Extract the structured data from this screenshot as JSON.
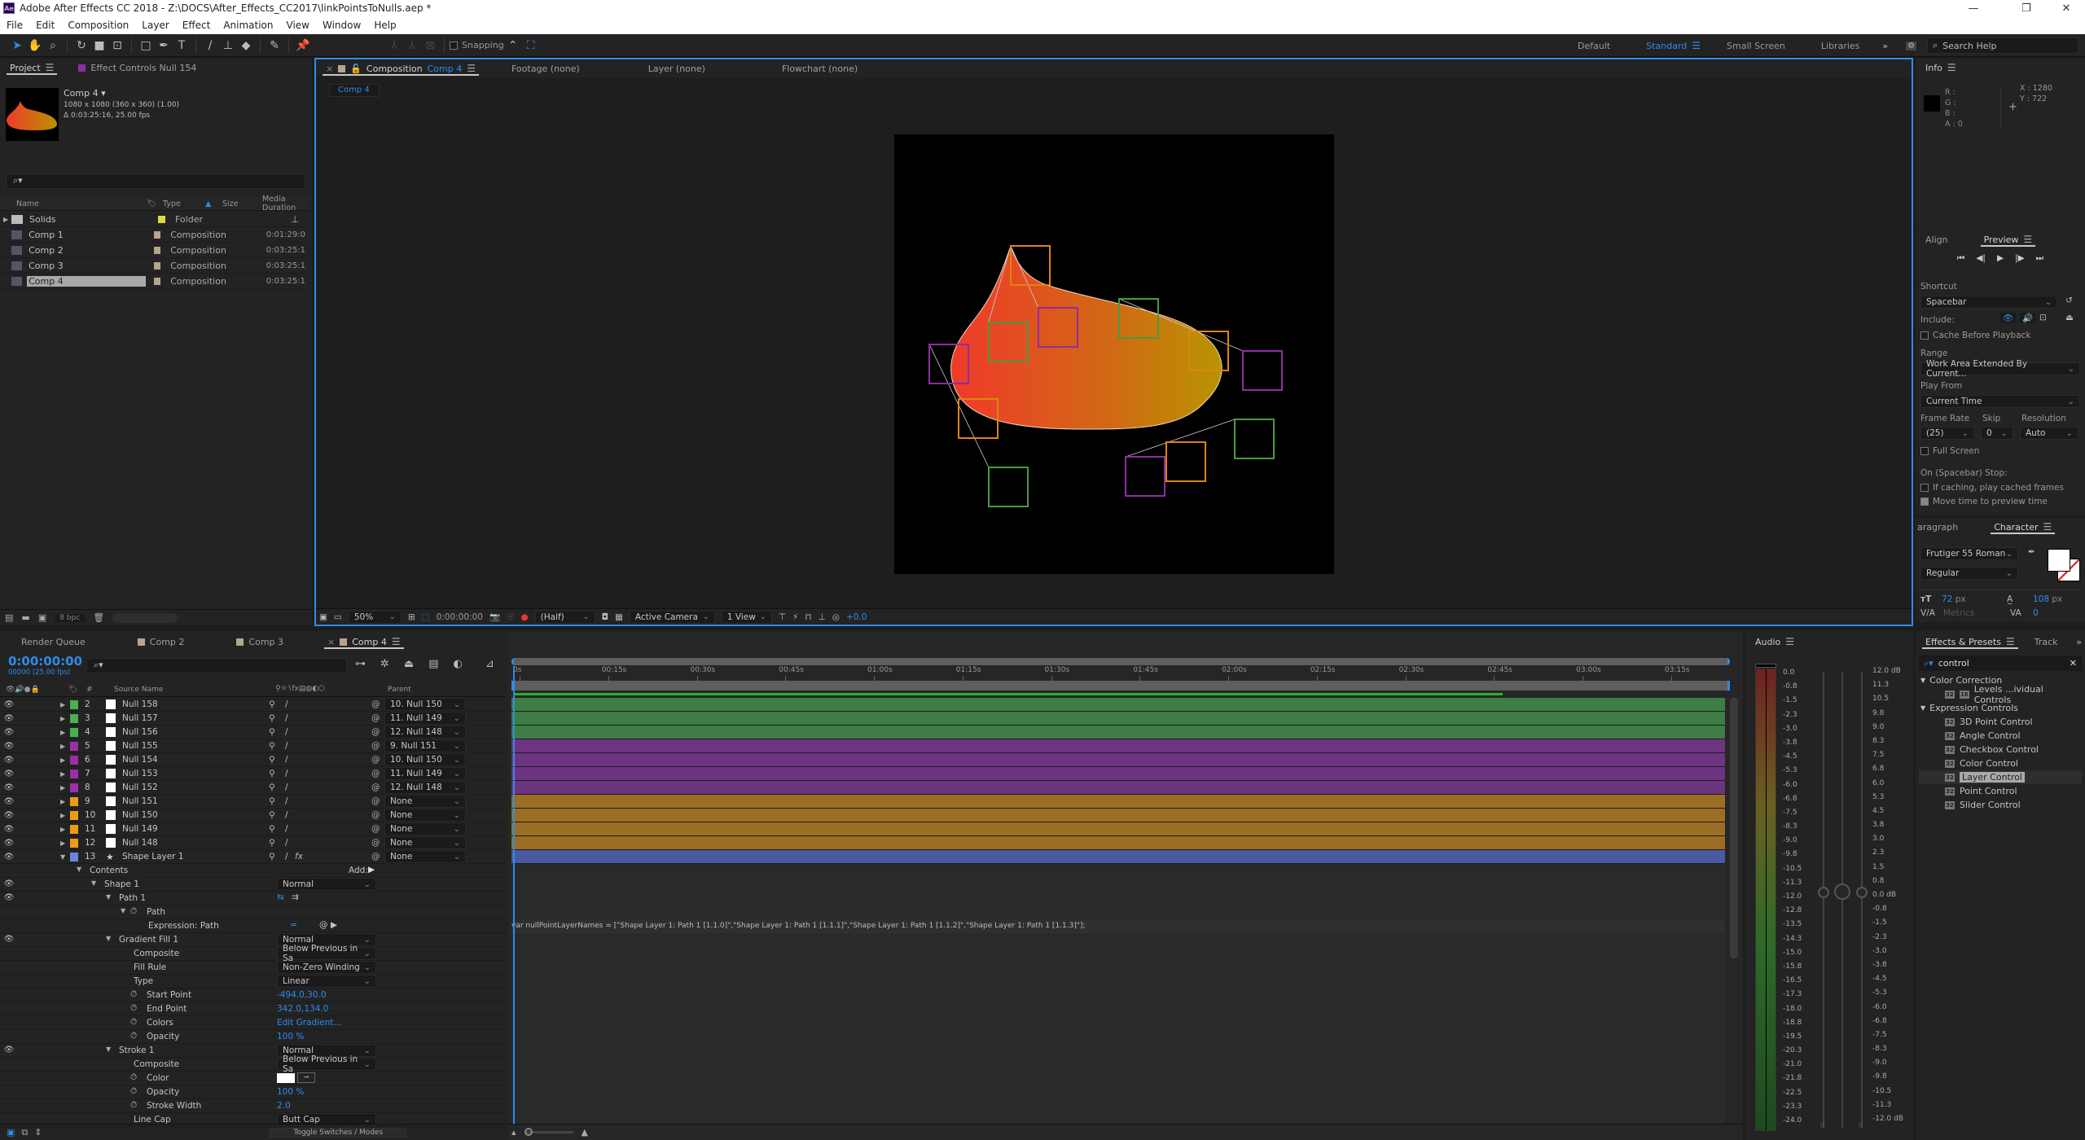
{
  "window": {
    "title": "Adobe After Effects CC 2018 - Z:\\DOCS\\After_Effects_CC2017\\linkPointsToNulls.aep *",
    "app_icon": "Ae",
    "controls": {
      "minimize": "—",
      "restore": "❐",
      "close": "✕"
    }
  },
  "menu": [
    "File",
    "Edit",
    "Composition",
    "Layer",
    "Effect",
    "Animation",
    "View",
    "Window",
    "Help"
  ],
  "toolbar": {
    "tools": [
      "selection-tool",
      "hand-tool",
      "zoom-tool",
      "rotation-tool",
      "camera-tool",
      "pan-behind-tool",
      "rectangle-tool",
      "pen-tool",
      "type-tool",
      "brush-tool",
      "clone-stamp-tool",
      "eraser-tool",
      "roto-brush-tool",
      "puppet-pin-tool"
    ],
    "snapping_label": "Snapping",
    "workspaces": [
      "Default",
      "Standard",
      "Small Screen",
      "Libraries"
    ],
    "active_workspace": "Standard",
    "search_placeholder": "Search Help"
  },
  "project": {
    "tabs": [
      {
        "label": "Project"
      },
      {
        "label": "Effect Controls Null 154",
        "color": "#8e2ea0"
      }
    ],
    "preview": {
      "name": "Comp 4 ▾",
      "dims": "1080 x 1080  (360 x 360) (1.00)",
      "duration": "Δ 0:03:25:16, 25.00 fps"
    },
    "search_placeholder": "",
    "columns": [
      "Name",
      "Type",
      "Size",
      "Media Duration"
    ],
    "items": [
      {
        "name": "Solids",
        "type": "Folder",
        "duration": "",
        "label": "#e2d543",
        "kind": "folder"
      },
      {
        "name": "Comp 1",
        "type": "Composition",
        "duration": "0:01:29:0",
        "label": "#b5a58a",
        "kind": "comp"
      },
      {
        "name": "Comp 2",
        "type": "Composition",
        "duration": "0:03:25:1",
        "label": "#b5a58a",
        "kind": "comp"
      },
      {
        "name": "Comp 3",
        "type": "Composition",
        "duration": "0:03:25:1",
        "label": "#b5a58a",
        "kind": "comp"
      },
      {
        "name": "Comp 4",
        "type": "Composition",
        "duration": "0:03:25:1",
        "label": "#b5a58a",
        "kind": "comp",
        "selected": true
      }
    ],
    "bpc": "8 bpc"
  },
  "composition": {
    "tabs": [
      {
        "label": "Composition",
        "comp": "Comp 4"
      },
      {
        "label": "Footage (none)"
      },
      {
        "label": "Layer (none)"
      },
      {
        "label": "Flowchart (none)"
      }
    ],
    "breadcrumb": "Comp 4",
    "footer": {
      "zoom": "50%",
      "timecode": "0:00:00:00",
      "resolution": "(Half)",
      "camera": "Active Camera",
      "views": "1 View",
      "exposure": "+0.0"
    }
  },
  "info": {
    "title": "Info",
    "r": "R :",
    "g": "G :",
    "b": "B :",
    "a": "A :",
    "a_value": "0",
    "x": "X : 1280",
    "y": "Y :  722"
  },
  "preview": {
    "tabs": [
      "Align",
      "Preview"
    ],
    "shortcut_label": "Shortcut",
    "shortcut": "Spacebar",
    "include_label": "Include:",
    "cache_before_playback": "Cache Before Playback",
    "range_label": "Range",
    "range": "Work Area Extended By Current...",
    "play_from_label": "Play From",
    "play_from": "Current Time",
    "frame_rate_label": "Frame Rate",
    "frame_rate": "(25)",
    "skip_label": "Skip",
    "skip": "0",
    "resolution_label": "Resolution",
    "resolution": "Auto",
    "full_screen": "Full Screen",
    "on_stop_label": "On (Spacebar) Stop:",
    "if_caching": "If caching, play cached frames",
    "move_time": "Move time to preview time",
    "move_time_checked": true
  },
  "character": {
    "tabs": [
      "aragraph",
      "Character"
    ],
    "font": "Frutiger 55 Roman",
    "style": "Regular",
    "size": "72",
    "size_unit": "px",
    "leading": "108",
    "leading_unit": "px",
    "kerning": "Metrics",
    "tracking": "0"
  },
  "timeline": {
    "tabs": [
      {
        "label": "Render Queue"
      },
      {
        "label": "Comp 2"
      },
      {
        "label": "Comp 3"
      },
      {
        "label": "Comp 4",
        "active": true
      }
    ],
    "timecode": "0:00:00:00",
    "frames": "00000 (25.00 fps)",
    "columns": {
      "num": "#",
      "source": "Source Name",
      "parent": "Parent"
    },
    "ruler": [
      "0s",
      "00:15s",
      "00:30s",
      "00:45s",
      "01:00s",
      "01:15s",
      "01:30s",
      "01:45s",
      "02:00s",
      "02:15s",
      "02:30s",
      "02:45s",
      "03:00s",
      "03:15s"
    ],
    "layers": [
      {
        "num": "2",
        "name": "Null 158",
        "label": "#4caf50",
        "parent": "10. Null 150",
        "bar": "#3e7d45"
      },
      {
        "num": "3",
        "name": "Null 157",
        "label": "#4caf50",
        "parent": "11. Null 149",
        "bar": "#3e7d45"
      },
      {
        "num": "4",
        "name": "Null 156",
        "label": "#4caf50",
        "parent": "12. Null 148",
        "bar": "#3e7d45"
      },
      {
        "num": "5",
        "name": "Null 155",
        "label": "#9c2fa8",
        "parent": "9. Null 151",
        "bar": "#6d3481"
      },
      {
        "num": "6",
        "name": "Null 154",
        "label": "#9c2fa8",
        "parent": "10. Null 150",
        "bar": "#6d3481"
      },
      {
        "num": "7",
        "name": "Null 153",
        "label": "#9c2fa8",
        "parent": "11. Null 149",
        "bar": "#6d3481"
      },
      {
        "num": "8",
        "name": "Null 152",
        "label": "#9c2fa8",
        "parent": "12. Null 148",
        "bar": "#6d3481"
      },
      {
        "num": "9",
        "name": "Null 151",
        "label": "#ef9a16",
        "parent": "None",
        "bar": "#9a6e23"
      },
      {
        "num": "10",
        "name": "Null 150",
        "label": "#ef9a16",
        "parent": "None",
        "bar": "#9a6e23"
      },
      {
        "num": "11",
        "name": "Null 149",
        "label": "#ef9a16",
        "parent": "None",
        "bar": "#9a6e23"
      },
      {
        "num": "12",
        "name": "Null 148",
        "label": "#ef9a16",
        "parent": "None",
        "bar": "#9a6e23"
      },
      {
        "num": "13",
        "name": "Shape Layer 1",
        "label": "#6b86e0",
        "parent": "None",
        "bar": "#4a5aa0",
        "shape": true
      }
    ],
    "properties": [
      {
        "indent": 1,
        "twirl": true,
        "name": "Contents",
        "value": "Add:",
        "kind": "add"
      },
      {
        "indent": 2,
        "twirl": true,
        "name": "Shape 1",
        "value": "Normal",
        "kind": "dd",
        "eye": true
      },
      {
        "indent": 3,
        "twirl": true,
        "name": "Path 1",
        "value": "",
        "kind": "pathbtns",
        "eye": true
      },
      {
        "indent": 4,
        "twirl": true,
        "stopwatch": true,
        "name": "Path",
        "value": "",
        "kind": "none"
      },
      {
        "indent": 5,
        "name": "Expression: Path",
        "value": "",
        "kind": "expr"
      },
      {
        "indent": 3,
        "twirl": true,
        "name": "Gradient Fill 1",
        "value": "Normal",
        "kind": "dd",
        "eye": true
      },
      {
        "indent": 4,
        "name": "Composite",
        "value": "Below Previous in Sa",
        "kind": "dd"
      },
      {
        "indent": 4,
        "name": "Fill Rule",
        "value": "Non-Zero Winding",
        "kind": "dd"
      },
      {
        "indent": 4,
        "name": "Type",
        "value": "Linear",
        "kind": "dd"
      },
      {
        "indent": 4,
        "stopwatch": true,
        "name": "Start Point",
        "value": "-494.0,30.0",
        "kind": "blue"
      },
      {
        "indent": 4,
        "stopwatch": true,
        "name": "End Point",
        "value": "342.0,134.0",
        "kind": "blue"
      },
      {
        "indent": 4,
        "stopwatch": true,
        "name": "Colors",
        "value": "Edit Gradient...",
        "kind": "blue"
      },
      {
        "indent": 4,
        "stopwatch": true,
        "name": "Opacity",
        "value": "100 %",
        "kind": "blue"
      },
      {
        "indent": 3,
        "twirl": true,
        "name": "Stroke 1",
        "value": "Normal",
        "kind": "dd",
        "eye": true
      },
      {
        "indent": 4,
        "name": "Composite",
        "value": "Below Previous in Sa",
        "kind": "dd"
      },
      {
        "indent": 4,
        "stopwatch": true,
        "name": "Color",
        "value": "",
        "kind": "color"
      },
      {
        "indent": 4,
        "stopwatch": true,
        "name": "Opacity",
        "value": "100 %",
        "kind": "blue"
      },
      {
        "indent": 4,
        "stopwatch": true,
        "name": "Stroke Width",
        "value": "2.0",
        "kind": "blue"
      },
      {
        "indent": 4,
        "name": "Line Cap",
        "value": "Butt Cap",
        "kind": "dd"
      }
    ],
    "expression_text": "var nullPointLayerNames = [\"Shape Layer 1: Path 1 [1.1.0]\",\"Shape Layer 1: Path 1 [1.1.1]\",\"Shape Layer 1: Path 1 [1.1.2]\",\"Shape Layer 1: Path 1 [1.1.3]\"];",
    "toggle_label": "Toggle Switches / Modes",
    "work_area_fraction": 0.815
  },
  "audio": {
    "title": "Audio",
    "left_scale": [
      "0.0",
      "-0.8",
      "-1.5",
      "-2.3",
      "-3.0",
      "-3.8",
      "-4.5",
      "-5.3",
      "-6.0",
      "-6.8",
      "-7.5",
      "-8.3",
      "-9.0",
      "-9.8",
      "-10.5",
      "-11.3",
      "-12.0",
      "-12.8",
      "-13.5",
      "-14.3",
      "-15.0",
      "-15.8",
      "-16.5",
      "-17.3",
      "-18.0",
      "-18.8",
      "-19.5",
      "-20.3",
      "-21.0",
      "-21.8",
      "-22.5",
      "-23.3",
      "-24.0"
    ],
    "right_scale": [
      "12.0 dB",
      "11.3",
      "10.5",
      "9.8",
      "9.0",
      "8.3",
      "7.5",
      "6.8",
      "6.0",
      "5.3",
      "4.5",
      "3.8",
      "3.0",
      "2.3",
      "1.5",
      "0.8",
      "0.0 dB",
      "-0.8",
      "-1.5",
      "-2.3",
      "-3.0",
      "-3.8",
      "-4.5",
      "-5.3",
      "-6.0",
      "-6.8",
      "-7.5",
      "-8.3",
      "-9.0",
      "-9.8",
      "-10.5",
      "-11.3",
      "-12.0 dB"
    ],
    "left_value": "0",
    "right_value": "0"
  },
  "effects": {
    "tabs": [
      "Effects & Presets",
      "Track"
    ],
    "search": "control",
    "groups": [
      {
        "name": "Color Correction",
        "items": [
          {
            "name": "Levels ...ividual Controls",
            "badge2": true
          }
        ]
      },
      {
        "name": "Expression Controls",
        "items": [
          {
            "name": "3D Point Control"
          },
          {
            "name": "Angle Control"
          },
          {
            "name": "Checkbox Control"
          },
          {
            "name": "Color Control"
          },
          {
            "name": "Layer Control",
            "selected": true
          },
          {
            "name": "Point Control"
          },
          {
            "name": "Slider Control"
          }
        ]
      }
    ]
  }
}
